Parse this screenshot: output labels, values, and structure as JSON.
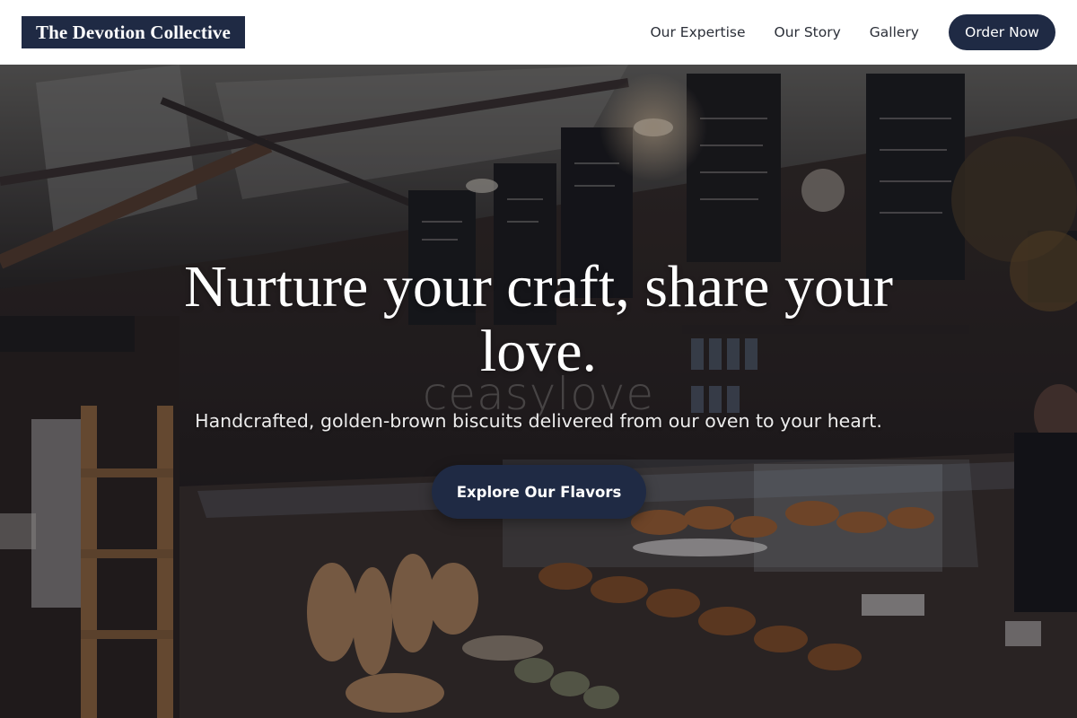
{
  "header": {
    "brand": "The Devotion Collective",
    "nav": [
      "Our Expertise",
      "Our Story",
      "Gallery"
    ],
    "cta": "Order Now"
  },
  "hero": {
    "title": "Nurture your craft, share your love.",
    "watermark": "ceasylove",
    "subtitle": "Handcrafted, golden-brown biscuits delivered from our oven to your heart.",
    "button": "Explore Our Flavors",
    "background_image": "bakery-interior-photo"
  },
  "colors": {
    "primary": "#1f2a44",
    "header_bg": "#ffffff",
    "nav_text": "#2b2f38",
    "hero_text": "#ffffff"
  }
}
